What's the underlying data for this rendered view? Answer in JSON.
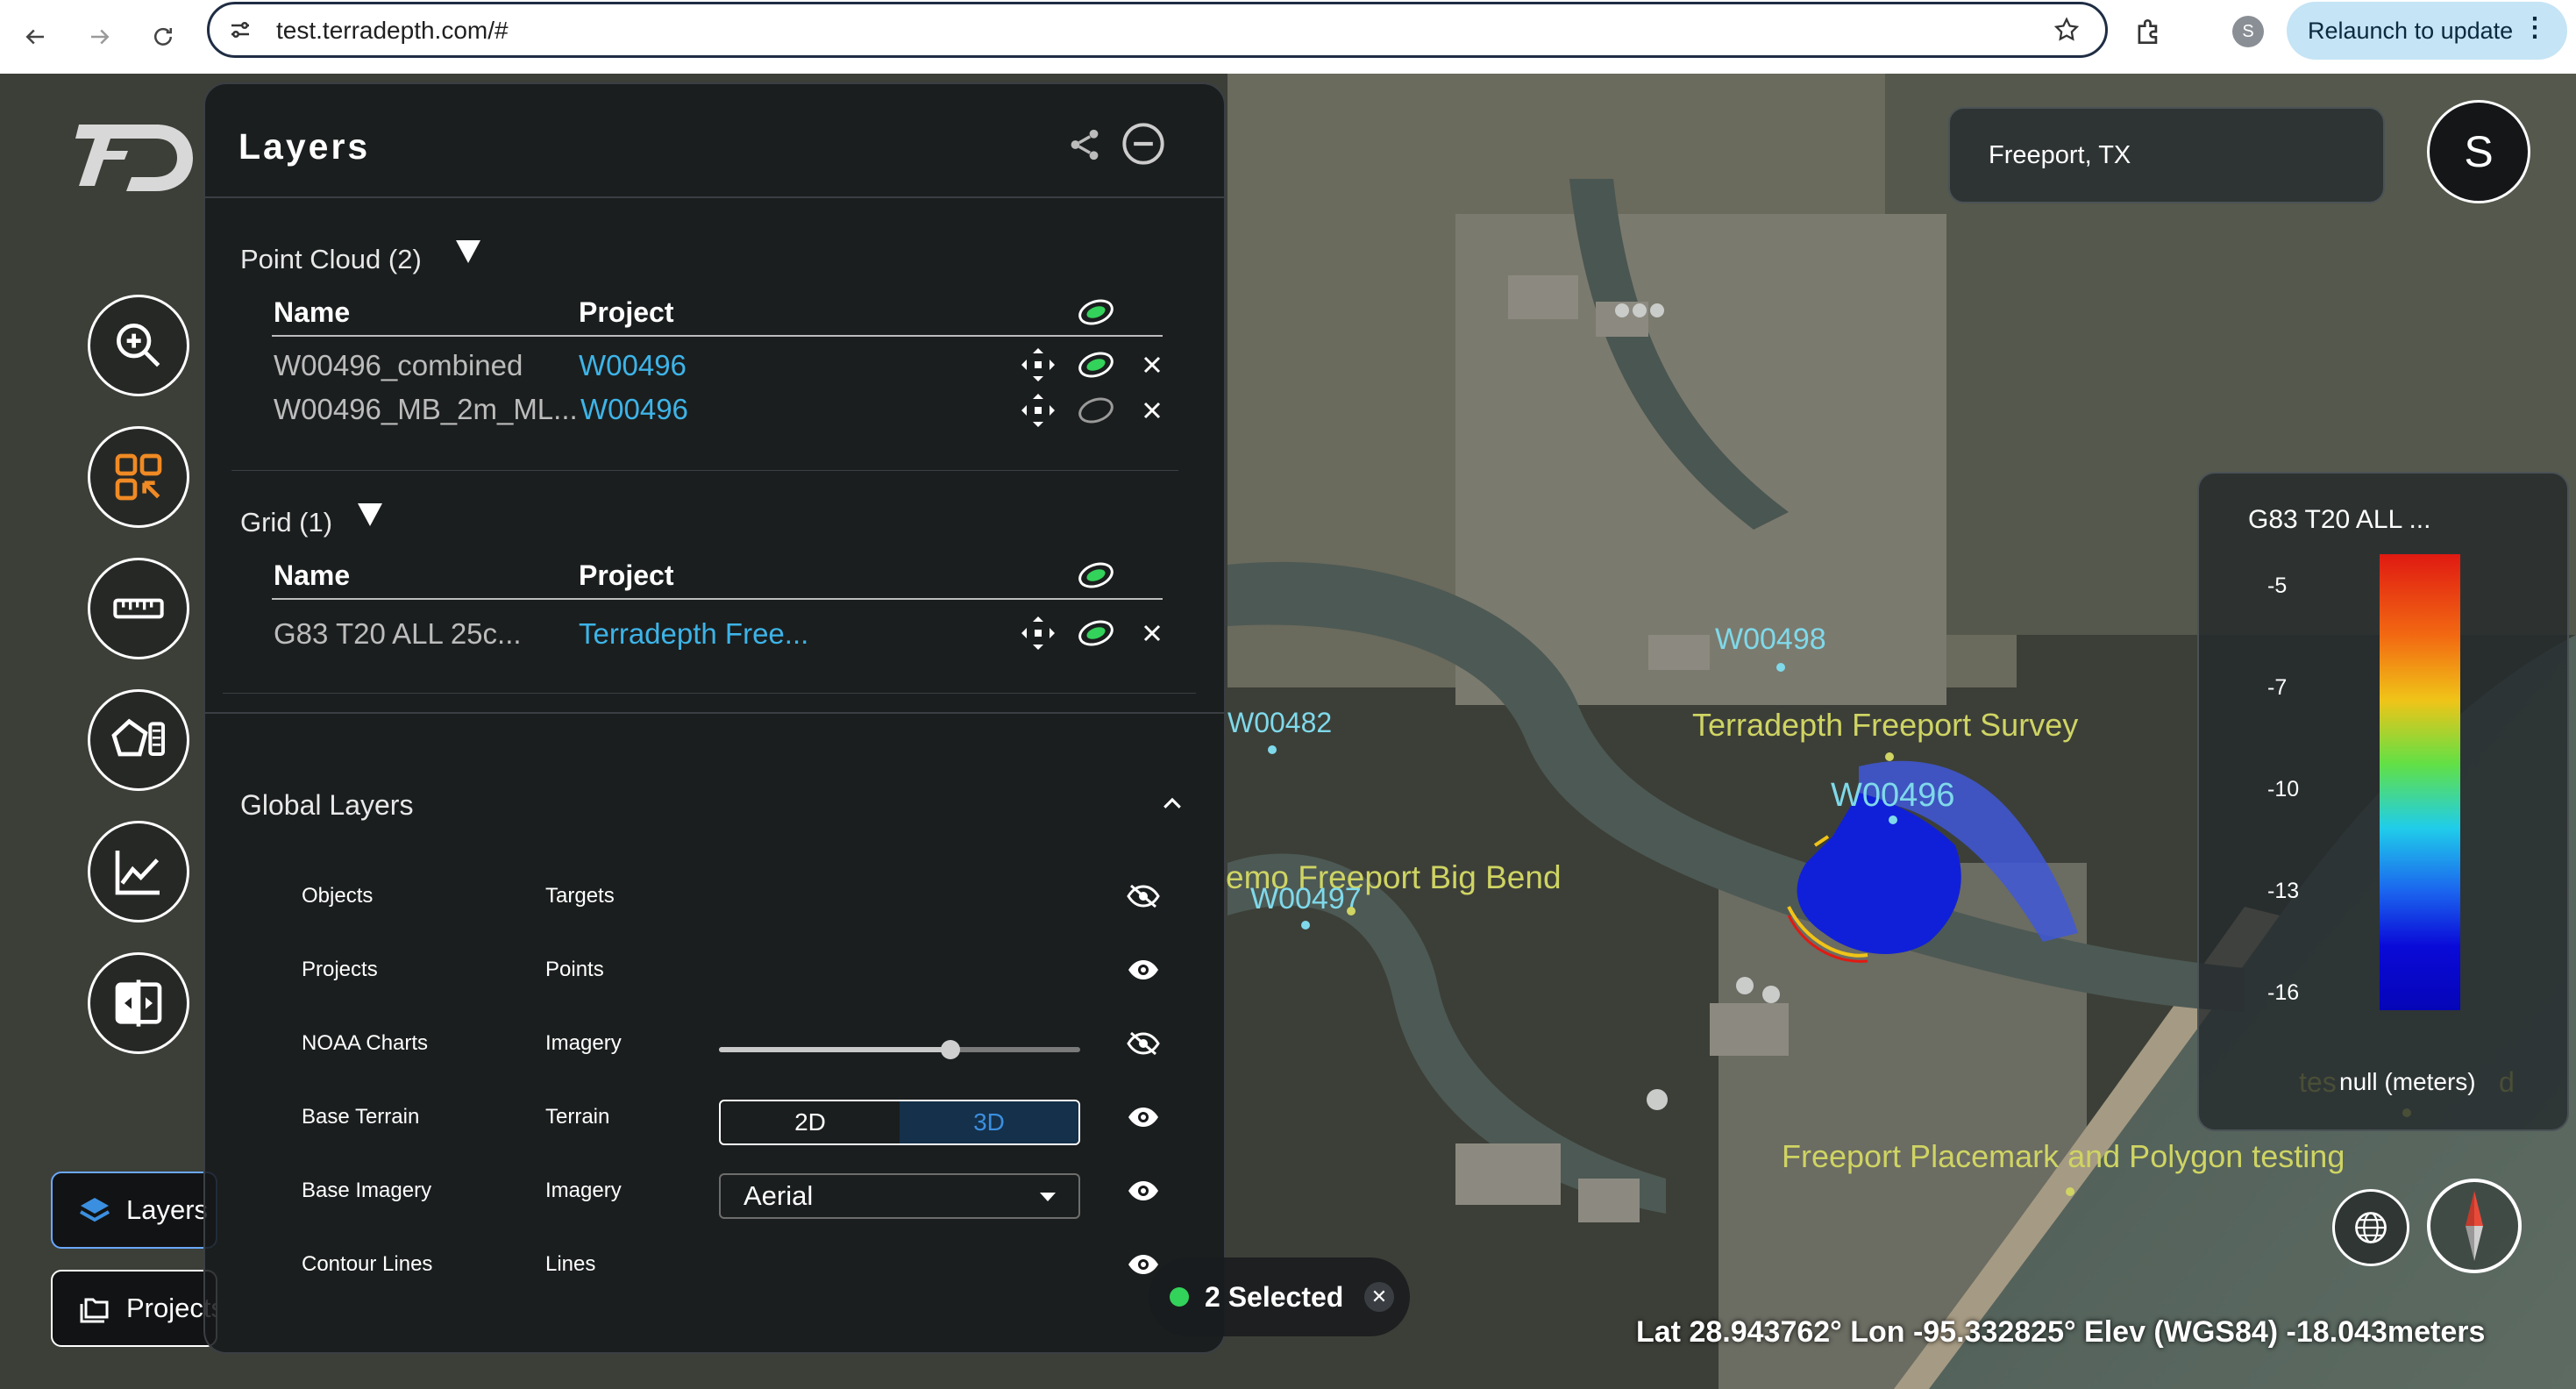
{
  "browser": {
    "url": "test.terradepth.com/#",
    "profile_initial": "S",
    "relaunch_label": "Relaunch to update"
  },
  "toolbar": {
    "tools": [
      "zoom-tool",
      "select-tool",
      "measure-tool",
      "polygon-tool",
      "profile-chart-tool",
      "compare-tool"
    ],
    "tabs": {
      "layers": "Layers",
      "projects": "Projects"
    }
  },
  "panel": {
    "title": "Layers",
    "point_cloud": {
      "title": "Point Cloud (2)",
      "col_name": "Name",
      "col_project": "Project",
      "rows": [
        {
          "name": "W00496_combined",
          "project": "W00496",
          "visible": true
        },
        {
          "name": "W00496_MB_2m_ML...",
          "project": "W00496",
          "visible": false
        }
      ]
    },
    "grid": {
      "title": "Grid (1)",
      "col_name": "Name",
      "col_project": "Project",
      "rows": [
        {
          "name": "G83 T20 ALL 25c...",
          "project": "Terradepth Free...",
          "visible": true
        }
      ]
    },
    "global_layers": {
      "title": "Global Layers",
      "rows": [
        {
          "name": "Objects",
          "type": "Targets",
          "visible": false
        },
        {
          "name": "Projects",
          "type": "Points",
          "visible": true
        },
        {
          "name": "NOAA Charts",
          "type": "Imagery",
          "visible": false,
          "opacity": 0.64
        },
        {
          "name": "Base Terrain",
          "type": "Terrain",
          "visible": true,
          "modes": [
            "2D",
            "3D"
          ],
          "selected_mode": "3D"
        },
        {
          "name": "Base Imagery",
          "type": "Imagery",
          "visible": true,
          "selected": "Aerial"
        },
        {
          "name": "Contour Lines",
          "type": "Lines",
          "visible": true
        }
      ]
    }
  },
  "map": {
    "location": "Freeport, TX",
    "user_initial": "S",
    "labels": {
      "w00498": "W00498",
      "w00482": "W00482",
      "survey": "Terradepth Freeport Survey",
      "w00496": "W00496",
      "big_bend": "emo Freeport Big Bend",
      "w00497": "W00497",
      "placemark": "Freeport Placemark and Polygon testing",
      "partial_a": "tes",
      "partial_b": "d"
    },
    "selected_label": "2 Selected",
    "coordinates": "Lat 28.943762° Lon -95.332825° Elev (WGS84) -18.043meters",
    "legend": {
      "title": "G83 T20 ALL ...",
      "ticks": [
        "-5",
        "-7",
        "-10",
        "-13",
        "-16"
      ],
      "unit": "null (meters)"
    }
  },
  "colors": {
    "accent_link": "#3db4e8",
    "visible_green": "#33d25a",
    "orange_tool": "#f08a24",
    "label_yellow": "#cfd463",
    "label_cyan": "#7fd9ea"
  }
}
